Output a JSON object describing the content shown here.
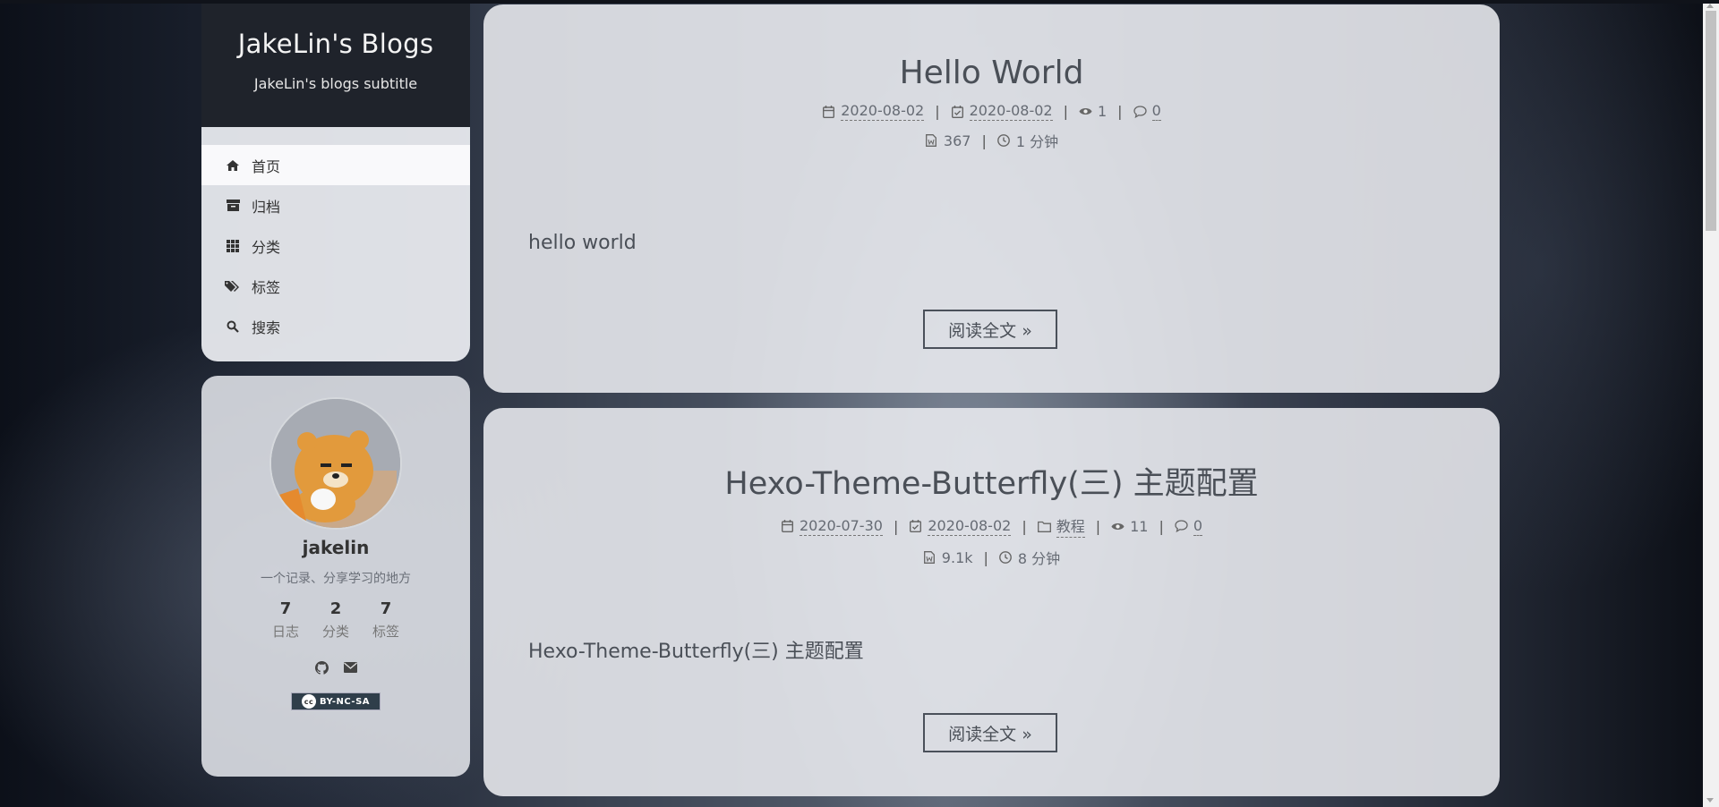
{
  "site": {
    "title": "JakeLin's Blogs",
    "subtitle": "JakeLin's blogs subtitle"
  },
  "menu": [
    {
      "label": "首页",
      "icon": "home-icon"
    },
    {
      "label": "归档",
      "icon": "archive-icon"
    },
    {
      "label": "分类",
      "icon": "th-icon"
    },
    {
      "label": "标签",
      "icon": "tags-icon"
    },
    {
      "label": "搜索",
      "icon": "search-icon"
    }
  ],
  "author": {
    "name": "jakelin",
    "description": "一个记录、分享学习的地方",
    "stats": [
      {
        "num": "7",
        "label": "日志"
      },
      {
        "num": "2",
        "label": "分类"
      },
      {
        "num": "7",
        "label": "标签"
      }
    ],
    "license": "BY-NC-SA"
  },
  "posts": [
    {
      "title": "Hello World",
      "created": "2020-08-02",
      "updated": "2020-08-02",
      "views": "1",
      "comments": "0",
      "words": "367",
      "read_time": "1 分钟",
      "excerpt": "hello world",
      "read_more": "阅读全文 »"
    },
    {
      "title": "Hexo-Theme-Butterfly(三) 主题配置",
      "created": "2020-07-30",
      "updated": "2020-08-02",
      "category": "教程",
      "views": "11",
      "comments": "0",
      "words": "9.1k",
      "read_time": "8 分钟",
      "excerpt": "Hexo-Theme-Butterfly(三) 主题配置",
      "read_more": "阅读全文 »"
    }
  ],
  "separator": "|"
}
